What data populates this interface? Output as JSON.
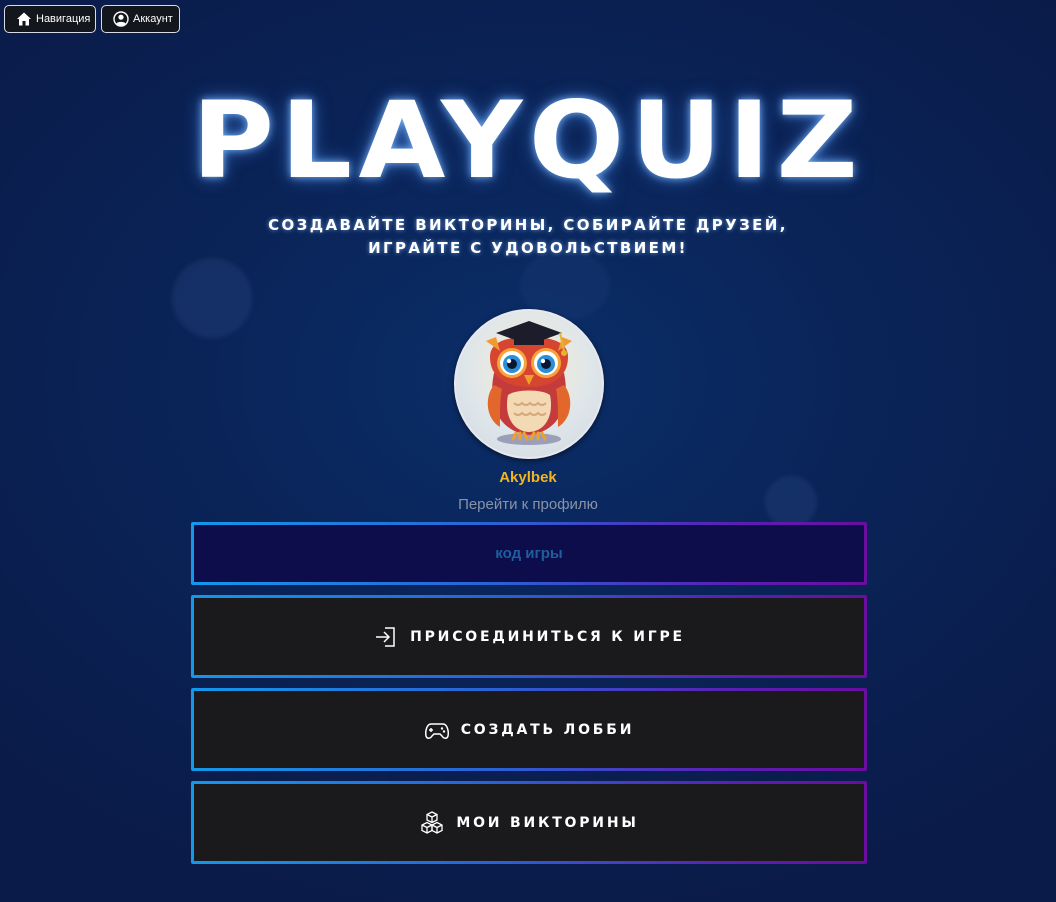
{
  "nav": {
    "navigation_label": "Навигация",
    "account_label": "Аккаунт"
  },
  "hero": {
    "title": "PLAYQUIZ",
    "tagline_line1": "СОЗДАВАЙТЕ ВИКТОРИНЫ, СОБИРАЙТЕ ДРУЗЕЙ,",
    "tagline_line2": "ИГРАЙТЕ С УДОВОЛЬСТВИЕМ!"
  },
  "profile": {
    "username": "Akylbek",
    "profile_link": "Перейти к профилю"
  },
  "game_code": {
    "value": "",
    "placeholder": "код игры"
  },
  "actions": {
    "join_label": "ПРИСОЕДИНИТЬСЯ К ИГРЕ",
    "create_lobby_label": "СОЗДАТЬ ЛОББИ",
    "my_quizzes_label": "МОИ ВИКТОРИНЫ"
  },
  "icons": {
    "home": "home-icon",
    "account": "user-circle-icon",
    "join": "sign-in-icon",
    "create_lobby": "gamepad-icon",
    "my_quizzes": "cubes-icon"
  },
  "colors": {
    "username": "#f2b51e",
    "gradient_start": "#1398ea",
    "gradient_end": "#6a0da0",
    "button_fill": "#1a1a1d",
    "code_fill": "#0d0d4b"
  }
}
